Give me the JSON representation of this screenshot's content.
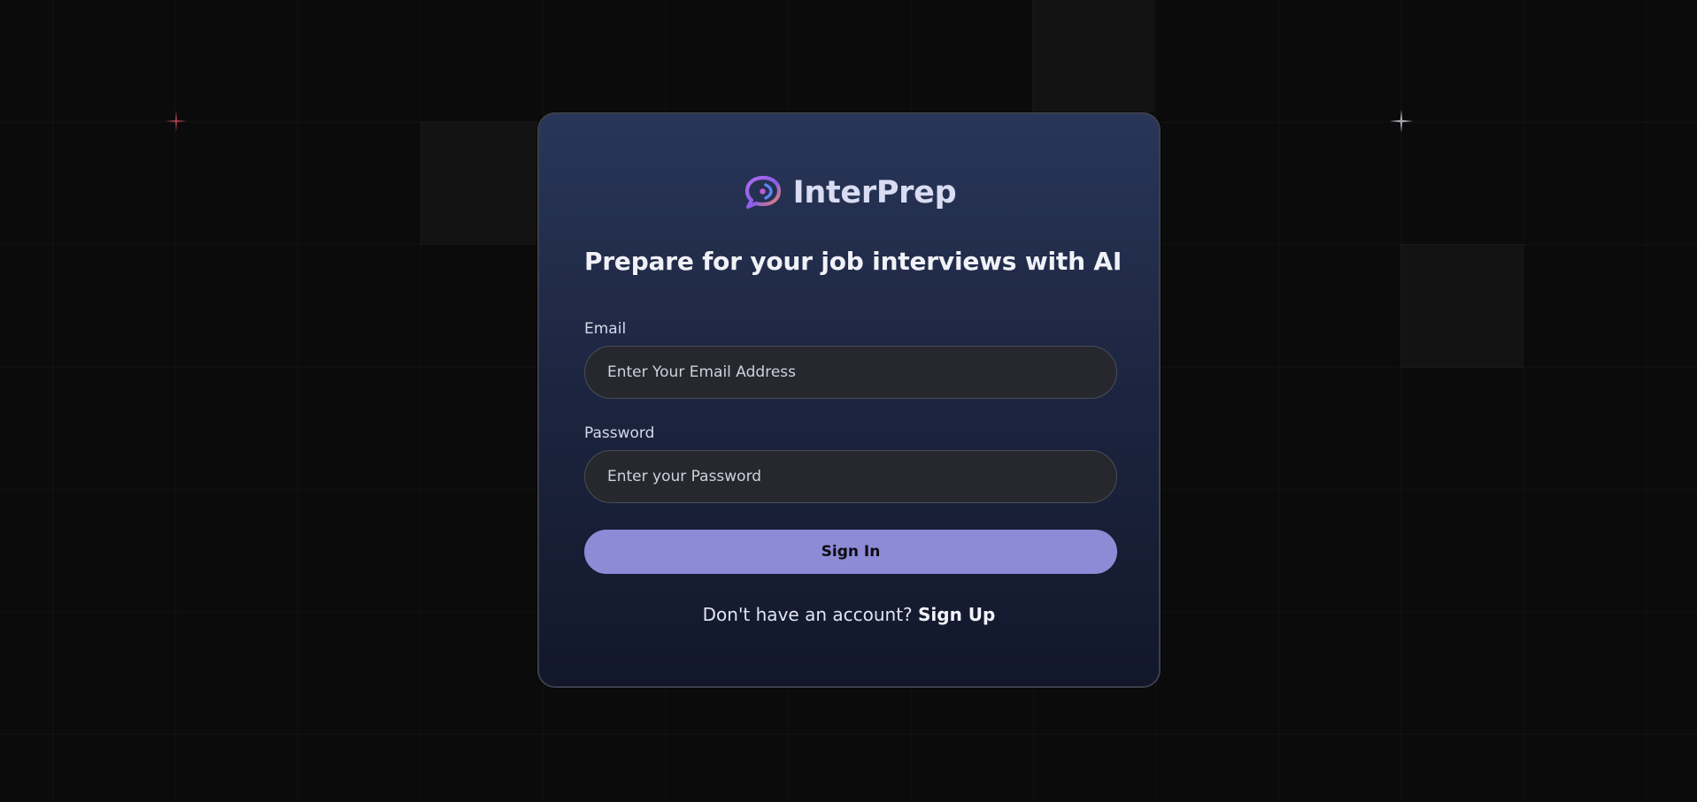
{
  "brand": {
    "name": "InterPrep",
    "logo_icon": "chat-bubble-logo-icon"
  },
  "hero": {
    "tagline": "Prepare for your job interviews with AI"
  },
  "form": {
    "email_label": "Email",
    "email_placeholder": "Enter Your Email Address",
    "email_value": "",
    "password_label": "Password",
    "password_placeholder": "Enter your Password",
    "password_value": "",
    "submit_label": "Sign In"
  },
  "footer": {
    "prompt": "Don't have an account?",
    "link_label": "Sign Up"
  },
  "colors": {
    "accent_button": "#8e8bd6",
    "card_top": "#293659",
    "card_bottom": "#12172a",
    "background": "#0b0b0c"
  }
}
